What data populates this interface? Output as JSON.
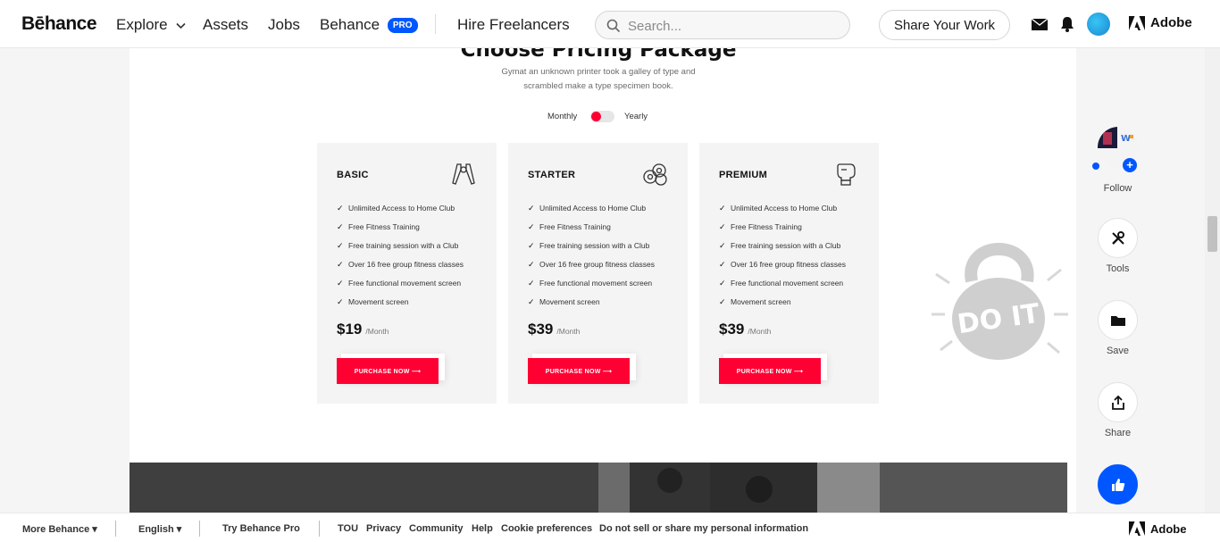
{
  "header": {
    "logo": "Bēhance",
    "nav": {
      "explore": "Explore",
      "assets": "Assets",
      "jobs": "Jobs",
      "behance": "Behance",
      "pro_badge": "PRO",
      "hire": "Hire Freelancers"
    },
    "search_placeholder": "Search...",
    "share_button": "Share Your Work",
    "adobe": "Adobe"
  },
  "project": {
    "heading": "Choose Pricing Package",
    "subtext": "Gymat an unknown printer took a galley of type and scrambled make a type specimen book.",
    "toggle": {
      "monthly": "Monthly",
      "yearly": "Yearly"
    },
    "cards": [
      {
        "name": "BASIC",
        "icon": "hand-grip-icon",
        "features": [
          "Unlimited Access to Home Club",
          "Free Fitness Training",
          "Free training session with a Club",
          "Over 16 free group fitness classes",
          "Free functional movement screen",
          "Movement screen"
        ],
        "price": "$19",
        "period": "/Month",
        "button": "PURCHASE NOW"
      },
      {
        "name": "STARTER",
        "icon": "weight-plates-icon",
        "features": [
          "Unlimited Access to Home Club",
          "Free Fitness Training",
          "Free training session with a Club",
          "Over 16 free group fitness classes",
          "Free functional movement screen",
          "Movement screen"
        ],
        "price": "$39",
        "period": "/Month",
        "button": "PURCHASE NOW"
      },
      {
        "name": "PREMIUM",
        "icon": "boxing-glove-icon",
        "features": [
          "Unlimited Access to Home Club",
          "Free Fitness Training",
          "Free training session with a Club",
          "Over 16 free group fitness classes",
          "Free functional movement screen",
          "Movement screen"
        ],
        "price": "$39",
        "period": "/Month",
        "button": "PURCHASE NOW"
      }
    ],
    "kettlebell_text": "DO IT"
  },
  "rail": {
    "follow": "Follow",
    "tools": "Tools",
    "save": "Save",
    "share": "Share"
  },
  "footer": {
    "more": "More Behance",
    "language": "English",
    "try_pro": "Try Behance Pro",
    "tou": "TOU",
    "privacy": "Privacy",
    "community": "Community",
    "help": "Help",
    "cookies": "Cookie preferences",
    "dns": "Do not sell or share my personal information",
    "adobe": "Adobe"
  },
  "colors": {
    "accent": "#ff0033",
    "behance_blue": "#0057ff"
  }
}
